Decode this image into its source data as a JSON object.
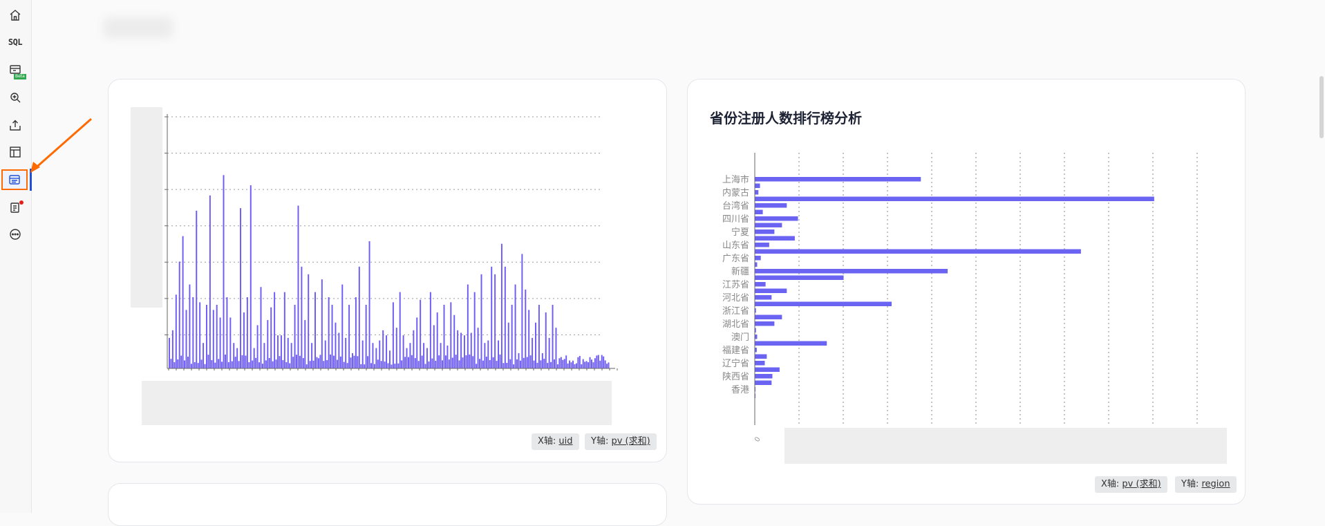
{
  "sidebar": {
    "sql_label": "SQL",
    "beta_label": "Beta",
    "icons": [
      "home-icon",
      "sql-icon",
      "dashboard-beta-icon",
      "zoom-in-icon",
      "upload-icon",
      "layout-icon",
      "data-card-icon",
      "report-icon",
      "more-icon"
    ]
  },
  "colors": {
    "bar": "#6e5cf6",
    "bar2": "#6b63f2",
    "active_border": "#ff6a00",
    "active_bar": "#1f4ed8"
  },
  "card1": {
    "x_tag_prefix": "X轴: ",
    "x_tag_value": "uid",
    "y_tag_prefix": "Y轴: ",
    "y_tag_value": "pv (求和)"
  },
  "card2": {
    "title": "省份注册人数排行榜分析",
    "x_tag_prefix": "X轴: ",
    "x_tag_value": "pv (求和)",
    "y_tag_prefix": "Y轴: ",
    "y_tag_value": "region",
    "x_tick_first": "0"
  },
  "chart_data": [
    {
      "type": "bar",
      "x_axis_field": "uid",
      "y_axis_field": "pv (求和)",
      "xlabel": "",
      "ylabel": "",
      "grid": true,
      "notes_visible_peaks": [
        0.12,
        0.15,
        0.29,
        0.42,
        0.52,
        0.23,
        0.33,
        0.28,
        0.62,
        0.26,
        0.1,
        0.25,
        0.68,
        0.23,
        0.25,
        0.2,
        0.76,
        0.28,
        0.2,
        0.1,
        0.08,
        0.63,
        0.22,
        0.28,
        0.72,
        0.08,
        0.17,
        0.32,
        0.1,
        0.19,
        0.24,
        0.3,
        0.13,
        0.13,
        0.3,
        0.12,
        0.1,
        0.25,
        0.64,
        0.4,
        0.19,
        0.37,
        0.1,
        0.3,
        0.04,
        0.35,
        0.11,
        0.28,
        0.25,
        0.18,
        0.14,
        0.33,
        0.12,
        0.25,
        0.06,
        0.28,
        0.4,
        0.11,
        0.25,
        0.5,
        0.1,
        0.08,
        0.11,
        0.15,
        0.13,
        0.07,
        0.26,
        0.16,
        0.3,
        0.13,
        0.08,
        0.1,
        0.15,
        0.2,
        0.27,
        0.1,
        0.08,
        0.3,
        0.17,
        0.22,
        0.1,
        0.25,
        0.09,
        0.26,
        0.21,
        0.15,
        0.14,
        0.13,
        0.33,
        0.14,
        0.3,
        0.16,
        0.37,
        0.1,
        0.11,
        0.4,
        0.37,
        0.11,
        0.49,
        0.4,
        0.18,
        0.25,
        0.33,
        0.06,
        0.45,
        0.31,
        0.23,
        0.12,
        0.18,
        0.25,
        0.06,
        0.22,
        0.12,
        0.25,
        0.16,
        0.04
      ]
    },
    {
      "type": "bar",
      "orientation": "horizontal",
      "title": "省份注册人数排行榜分析",
      "xlabel": "",
      "ylabel": "",
      "x_axis_field": "pv (求和)",
      "y_axis_field": "region",
      "grid": true,
      "categories": [
        "上海市",
        "",
        "内蒙古",
        "",
        "台湾省",
        "",
        "四川省",
        "",
        "宁夏",
        "",
        "山东省",
        "",
        "广东省",
        "",
        "新疆",
        "",
        "江苏省",
        "",
        "河北省",
        "",
        "浙江省",
        "",
        "湖北省",
        "",
        "澳门",
        "",
        "福建省",
        "",
        "辽宁省",
        "",
        "陕西省",
        "",
        "香港",
        ""
      ],
      "values": [
        0.415,
        0.013,
        0.009,
        0.998,
        0.08,
        0.02,
        0.108,
        0.068,
        0.049,
        0.1,
        0.036,
        0.815,
        0.015,
        0.006,
        0.482,
        0.222,
        0.027,
        0.08,
        0.042,
        0.342,
        0.003,
        0.068,
        0.049,
        0.003,
        0.006,
        0.18,
        0.005,
        0.03,
        0.025,
        0.062,
        0.044,
        0.042
      ]
    }
  ]
}
